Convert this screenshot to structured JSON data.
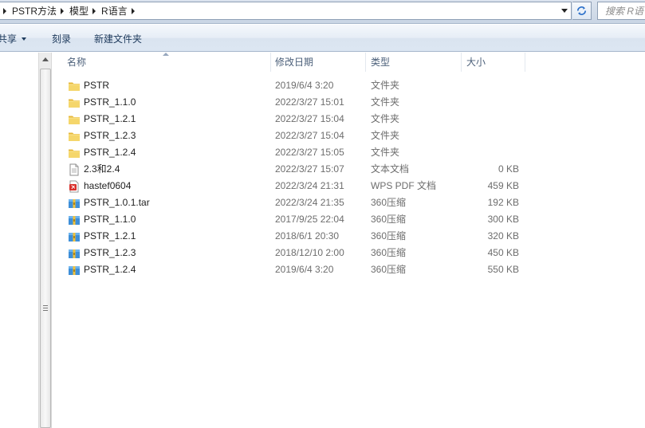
{
  "address": {
    "breadcrumbs": [
      "PSTR方法",
      "模型",
      "R语言"
    ]
  },
  "search": {
    "placeholder": "搜索 R语言"
  },
  "toolbar": {
    "share_label": "共享",
    "burn_label": "刻录",
    "new_folder_label": "新建文件夹"
  },
  "columns": {
    "name": "名称",
    "date": "修改日期",
    "type": "类型",
    "size": "大小"
  },
  "files": [
    {
      "icon": "folder-icon",
      "name": "PSTR",
      "date": "2019/6/4 3:20",
      "type": "文件夹",
      "size": ""
    },
    {
      "icon": "folder-icon",
      "name": "PSTR_1.1.0",
      "date": "2022/3/27 15:01",
      "type": "文件夹",
      "size": ""
    },
    {
      "icon": "folder-icon",
      "name": "PSTR_1.2.1",
      "date": "2022/3/27 15:04",
      "type": "文件夹",
      "size": ""
    },
    {
      "icon": "folder-icon",
      "name": "PSTR_1.2.3",
      "date": "2022/3/27 15:04",
      "type": "文件夹",
      "size": ""
    },
    {
      "icon": "folder-icon",
      "name": "PSTR_1.2.4",
      "date": "2022/3/27 15:05",
      "type": "文件夹",
      "size": ""
    },
    {
      "icon": "text-file-icon",
      "name": "2.3和2.4",
      "date": "2022/3/27 15:07",
      "type": "文本文档",
      "size": "0 KB"
    },
    {
      "icon": "pdf-file-icon",
      "name": "hastef0604",
      "date": "2022/3/24 21:31",
      "type": "WPS PDF 文档",
      "size": "459 KB"
    },
    {
      "icon": "archive-icon",
      "name": "PSTR_1.0.1.tar",
      "date": "2022/3/24 21:35",
      "type": "360压缩",
      "size": "192 KB"
    },
    {
      "icon": "archive-icon",
      "name": "PSTR_1.1.0",
      "date": "2017/9/25 22:04",
      "type": "360压缩",
      "size": "300 KB"
    },
    {
      "icon": "archive-icon",
      "name": "PSTR_1.2.1",
      "date": "2018/6/1 20:30",
      "type": "360压缩",
      "size": "320 KB"
    },
    {
      "icon": "archive-icon",
      "name": "PSTR_1.2.3",
      "date": "2018/12/10 2:00",
      "type": "360压缩",
      "size": "450 KB"
    },
    {
      "icon": "archive-icon",
      "name": "PSTR_1.2.4",
      "date": "2019/6/4 3:20",
      "type": "360压缩",
      "size": "550 KB"
    }
  ]
}
